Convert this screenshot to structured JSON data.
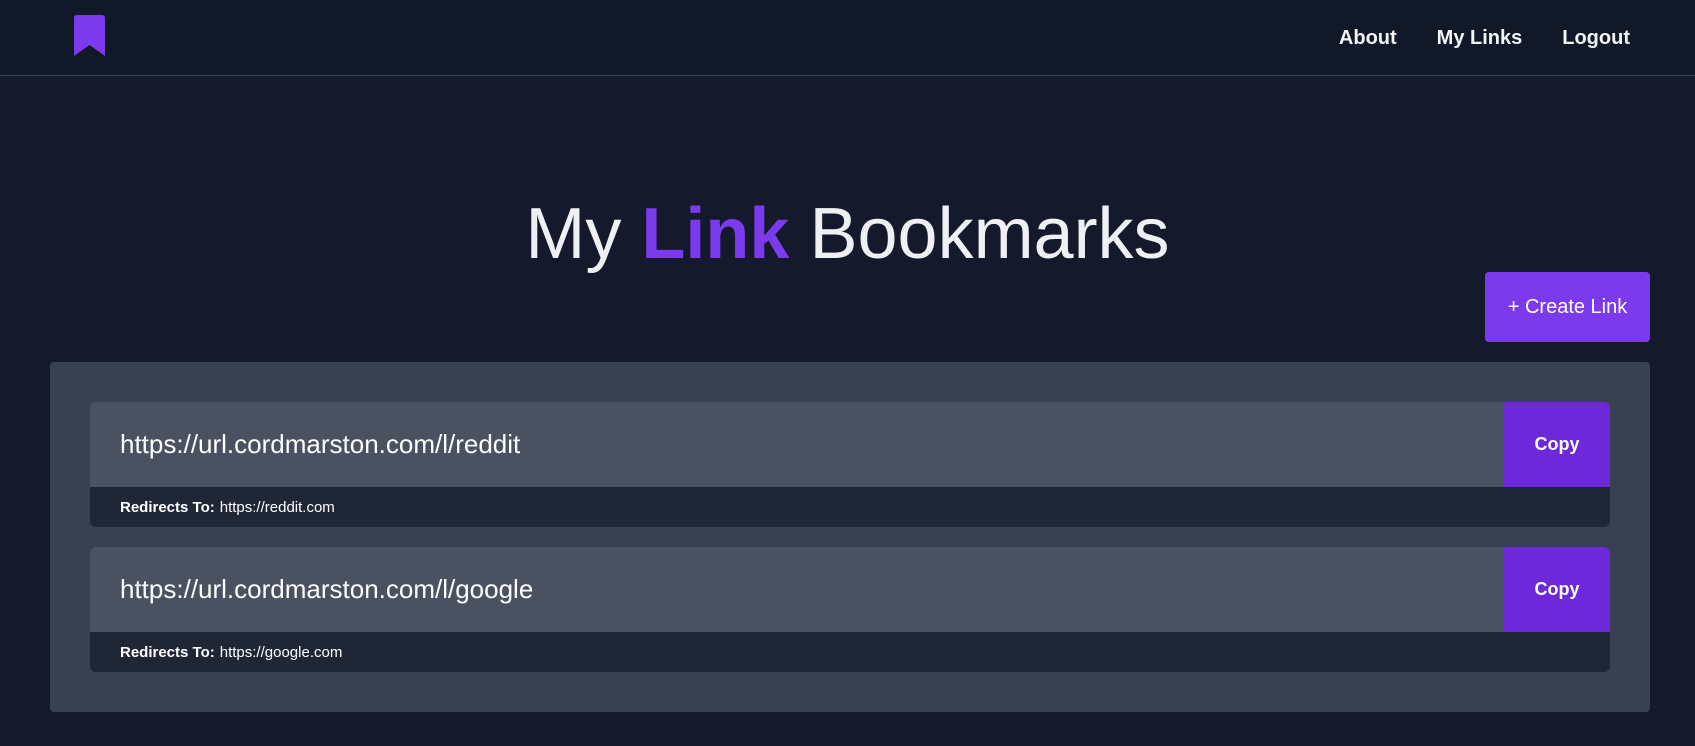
{
  "nav": {
    "logo_icon": "bookmark-icon",
    "links": [
      {
        "label": "About"
      },
      {
        "label": "My Links"
      },
      {
        "label": "Logout"
      }
    ]
  },
  "hero": {
    "title_prefix": "My",
    "title_accent": "Link",
    "title_suffix": "Bookmarks"
  },
  "create_button": {
    "label": "+ Create Link"
  },
  "links": [
    {
      "short_url": "https://url.cordmarston.com/l/reddit",
      "copy_label": "Copy",
      "redirect_label": "Redirects To:",
      "redirect_url": "https://reddit.com"
    },
    {
      "short_url": "https://url.cordmarston.com/l/google",
      "copy_label": "Copy",
      "redirect_label": "Redirects To:",
      "redirect_url": "https://google.com"
    }
  ],
  "colors": {
    "background": "#141a2b",
    "navbar": "#111827",
    "accent": "#7c3aed",
    "copy_button": "#6d28d9",
    "panel": "#384152",
    "card_top": "#4a5262",
    "card_bottom": "#1f2737"
  }
}
